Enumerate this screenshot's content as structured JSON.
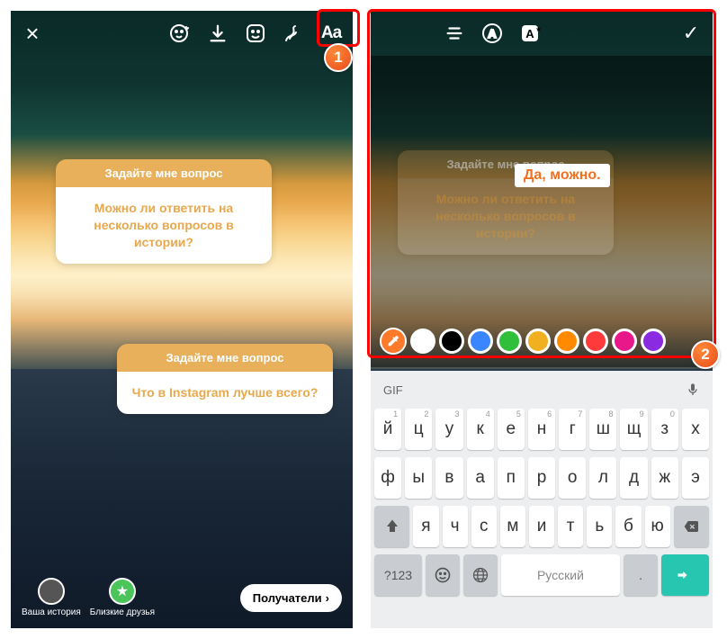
{
  "left": {
    "topbar": {
      "aa_label": "Aa"
    },
    "sticker1": {
      "header": "Задайте мне вопрос",
      "body": "Можно ли ответить на несколько вопросов в истории?"
    },
    "sticker2": {
      "header": "Задайте мне вопрос",
      "body": "Что в Instagram лучше всего?"
    },
    "bottom": {
      "your_story": "Ваша история",
      "close_friends": "Близкие друзья",
      "recipients": "Получатели"
    }
  },
  "right": {
    "sticker": {
      "header": "Задайте мне вопрос",
      "body": "Можно ли ответить на несколько вопросов в истории?"
    },
    "typed_text": "Да, можно.",
    "colors": [
      "#ffffff",
      "#000000",
      "#3a86ff",
      "#2fbf3a",
      "#f0b020",
      "#ff8a00",
      "#ff3a3a",
      "#e8188a",
      "#8a2be2"
    ],
    "keyboard": {
      "gif": "GIF",
      "row1": [
        "й",
        "ц",
        "у",
        "к",
        "е",
        "н",
        "г",
        "ш",
        "щ",
        "з",
        "х"
      ],
      "row1_sup": [
        "1",
        "2",
        "3",
        "4",
        "5",
        "6",
        "7",
        "8",
        "9",
        "0",
        ""
      ],
      "row2": [
        "ф",
        "ы",
        "в",
        "а",
        "п",
        "р",
        "о",
        "л",
        "д",
        "ж",
        "э"
      ],
      "row3": [
        "я",
        "ч",
        "с",
        "м",
        "и",
        "т",
        "ь",
        "б",
        "ю"
      ],
      "switch": "?123",
      "space": "Русский"
    }
  },
  "badges": {
    "b1": "1",
    "b2": "2"
  }
}
